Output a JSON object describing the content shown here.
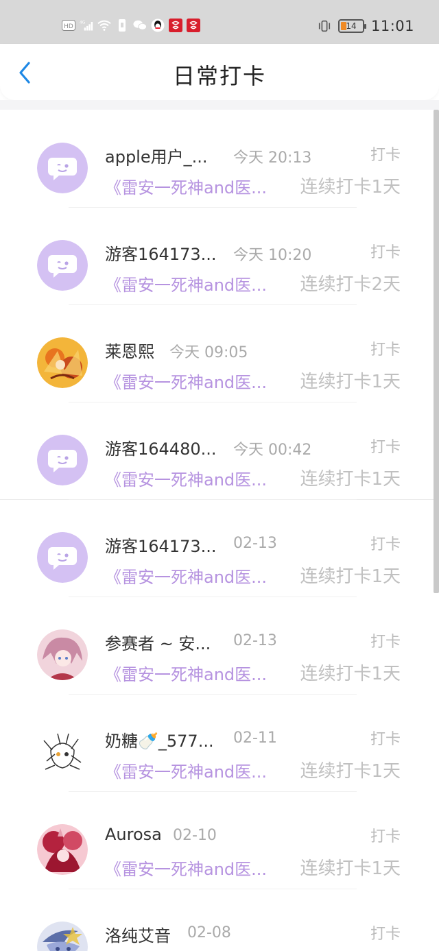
{
  "status_bar": {
    "left_icons": [
      "hd-icon",
      "signal-4g-icon",
      "wifi-icon",
      "sim-icon",
      "wechat-icon",
      "qq-icon",
      "app-badge-icon",
      "app-badge-icon"
    ],
    "network_label": "4G",
    "hd_label": "HD",
    "battery": "14",
    "time": "11:01"
  },
  "nav": {
    "title": "日常打卡"
  },
  "colors": {
    "book_link": "#b693e0",
    "default_avatar_bg": "#d4c1f3"
  },
  "entries": [
    {
      "name": "apple用户_...",
      "time": "今天 20:13",
      "tag": "打卡",
      "book": "《雷安一死神and医...",
      "streak": "连续打卡1天",
      "avatar": "default"
    },
    {
      "name": "游客164173...",
      "time": "今天 10:20",
      "tag": "打卡",
      "book": "《雷安一死神and医...",
      "streak": "连续打卡2天",
      "avatar": "default"
    },
    {
      "name": "莱恩熙",
      "time": "今天 09:05",
      "tag": "打卡",
      "book": "《雷安一死神and医...",
      "streak": "连续打卡1天",
      "avatar": "orange"
    },
    {
      "name": "游客164480...",
      "time": "今天 00:42",
      "tag": "打卡",
      "book": "《雷安一死神and医...",
      "streak": "连续打卡1天",
      "avatar": "default"
    },
    {
      "name": "游客164173...",
      "time": "02-13",
      "tag": "打卡",
      "book": "《雷安一死神and医...",
      "streak": "连续打卡1天",
      "avatar": "default"
    },
    {
      "name": "参赛者 ~ 安...",
      "time": "02-13",
      "tag": "打卡",
      "book": "《雷安一死神and医...",
      "streak": "连续打卡1天",
      "avatar": "pink"
    },
    {
      "name": "奶糖🍼_577...",
      "time": "02-11",
      "tag": "打卡",
      "book": "《雷安一死神and医...",
      "streak": "连续打卡1天",
      "avatar": "sketch"
    },
    {
      "name": "Aurosa",
      "time": "02-10",
      "tag": "打卡",
      "book": "《雷安一死神and医...",
      "streak": "连续打卡1天",
      "avatar": "red"
    },
    {
      "name": "洛纯艾音",
      "time": "02-08",
      "tag": "打卡",
      "book": "",
      "streak": "",
      "avatar": "blue"
    }
  ]
}
